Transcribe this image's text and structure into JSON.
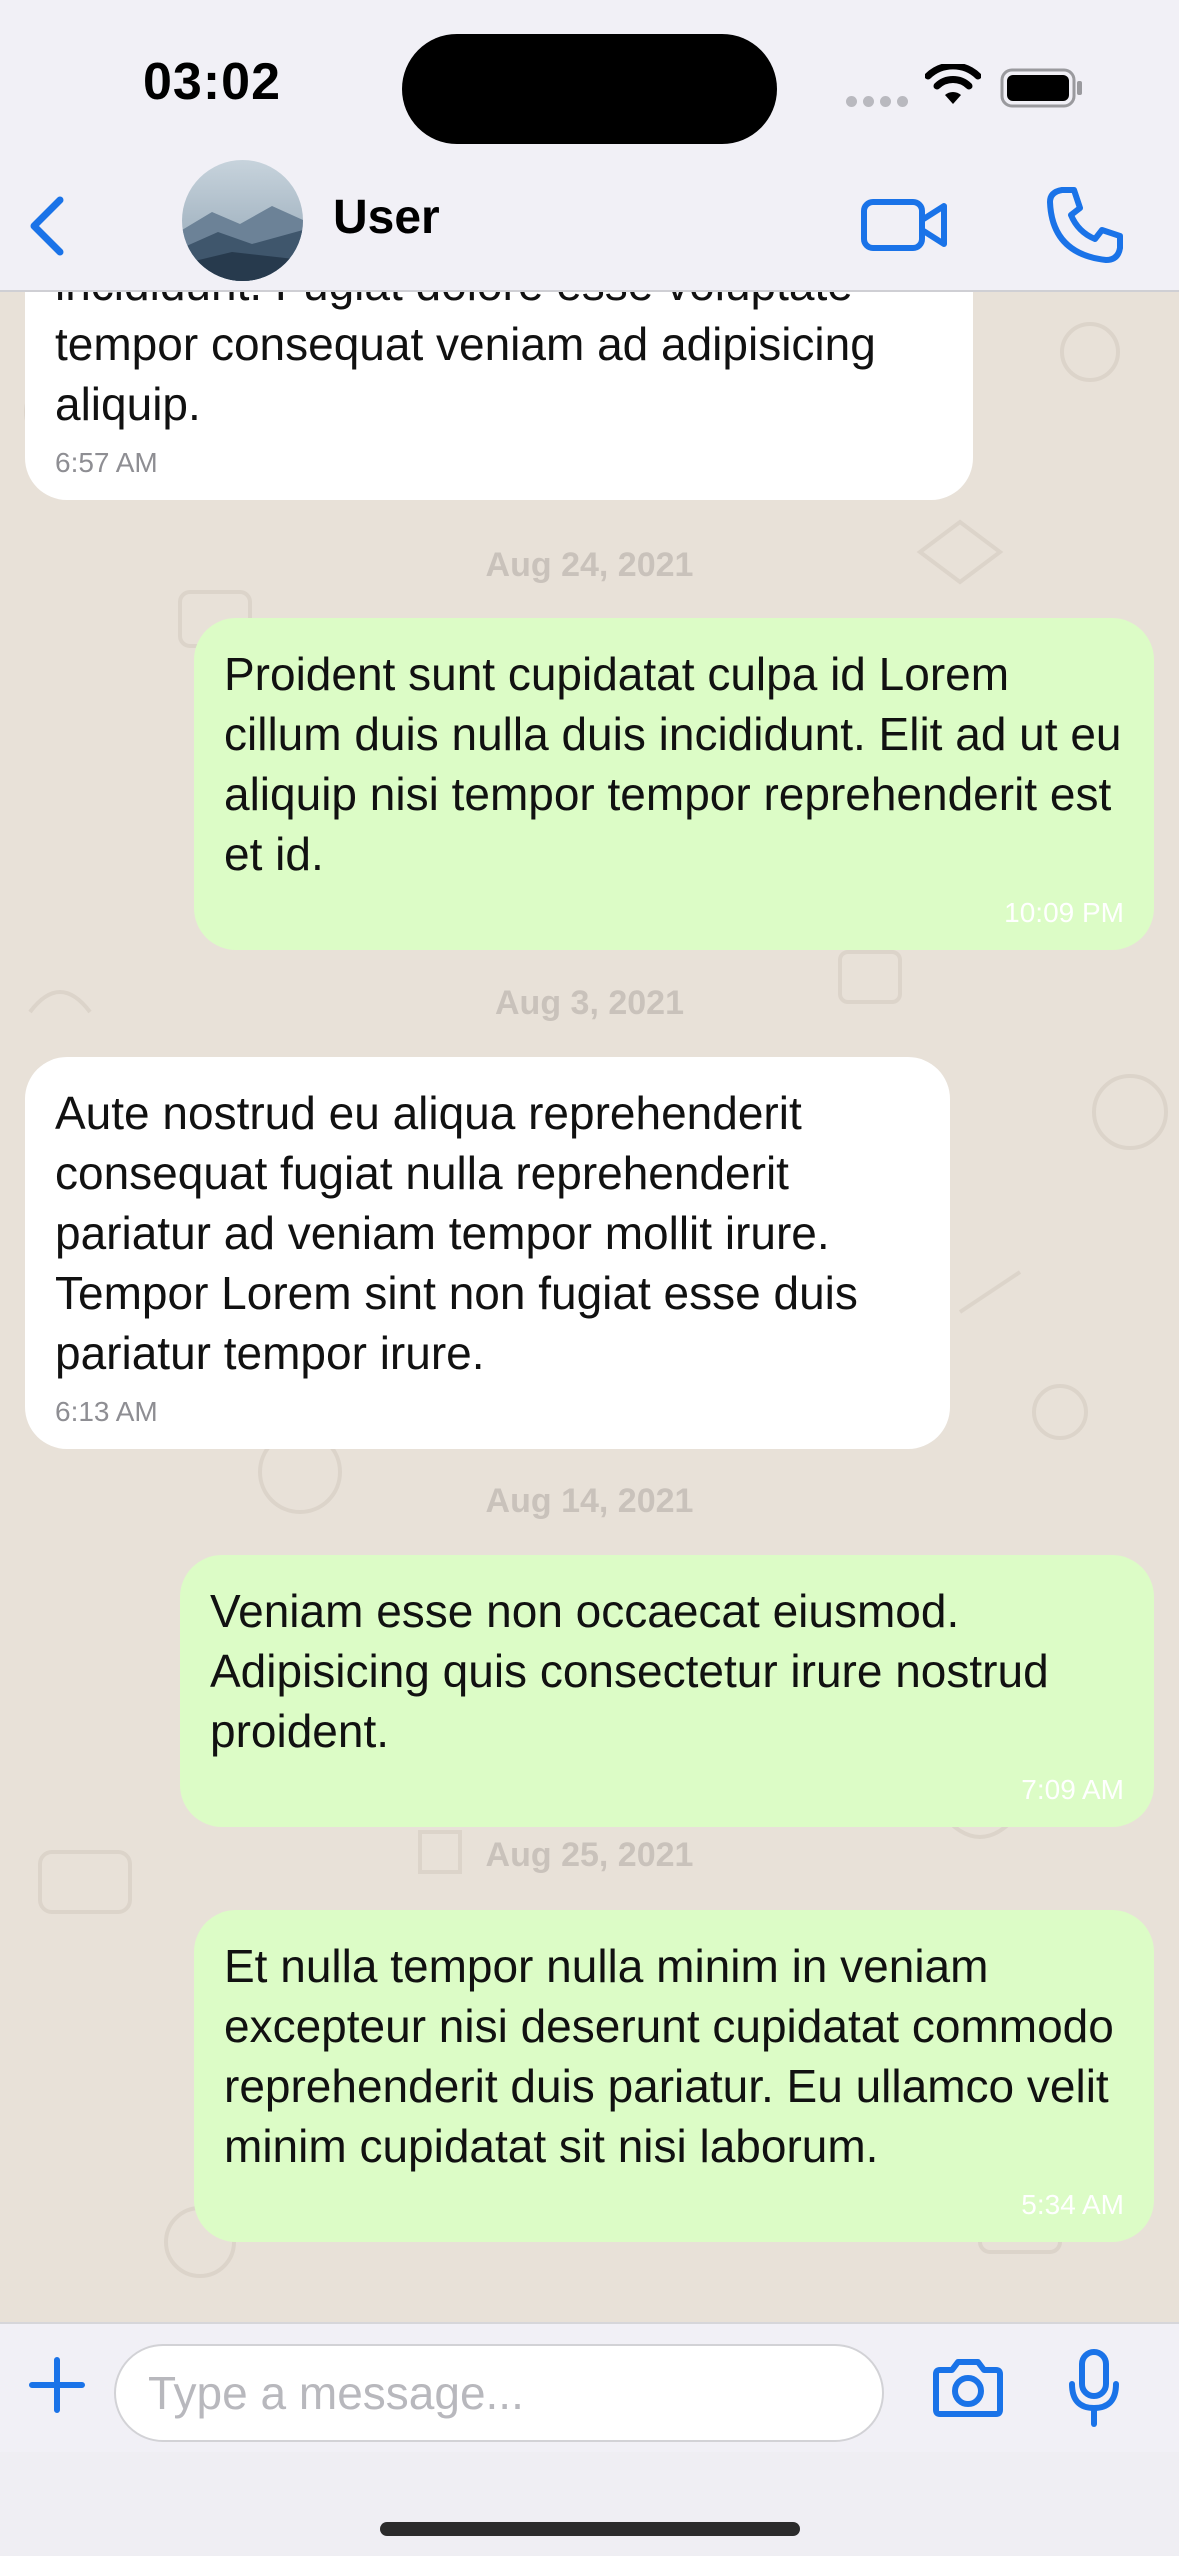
{
  "status_bar": {
    "time": "03:02"
  },
  "header": {
    "contact_name": "User"
  },
  "chat": {
    "items": [
      {
        "type": "message",
        "direction": "in",
        "text": "incididunt. Fugiat dolore esse voluptate tempor consequat veniam ad adipisicing aliquip.",
        "time": "6:57 AM"
      },
      {
        "type": "date",
        "text": "Aug 24, 2021"
      },
      {
        "type": "message",
        "direction": "out",
        "text": "Proident sunt cupidatat culpa id Lorem cillum duis nulla duis incididunt. Elit ad ut eu aliquip nisi tempor tempor reprehenderit est et id.",
        "time": "10:09 PM"
      },
      {
        "type": "date",
        "text": "Aug 3, 2021"
      },
      {
        "type": "message",
        "direction": "in",
        "text": "Aute nostrud eu aliqua reprehenderit consequat fugiat nulla reprehenderit pariatur ad veniam tempor mollit irure. Tempor Lorem sint non fugiat esse duis pariatur tempor irure.",
        "time": "6:13 AM"
      },
      {
        "type": "date",
        "text": "Aug 14, 2021"
      },
      {
        "type": "message",
        "direction": "out",
        "text": "Veniam esse non occaecat eiusmod. Adipisicing quis consectetur irure nostrud proident.",
        "time": "7:09 AM"
      },
      {
        "type": "date",
        "text": "Aug 25, 2021"
      },
      {
        "type": "message",
        "direction": "out",
        "text": "Et nulla tempor nulla minim in veniam excepteur nisi deserunt cupidatat commodo reprehenderit duis pariatur. Eu ullamco velit minim cupidatat sit nisi laborum.",
        "time": "5:34 AM"
      }
    ]
  },
  "composer": {
    "placeholder": "Type a message...",
    "value": ""
  },
  "colors": {
    "accent": "#1a73e8",
    "outgoing_bubble": "#dcfcc6",
    "incoming_bubble": "#ffffff",
    "wallpaper": "#e8e1d8"
  },
  "icons": [
    "back-icon",
    "video-call-icon",
    "phone-call-icon",
    "plus-icon",
    "camera-icon",
    "microphone-icon",
    "wifi-icon",
    "battery-icon"
  ]
}
